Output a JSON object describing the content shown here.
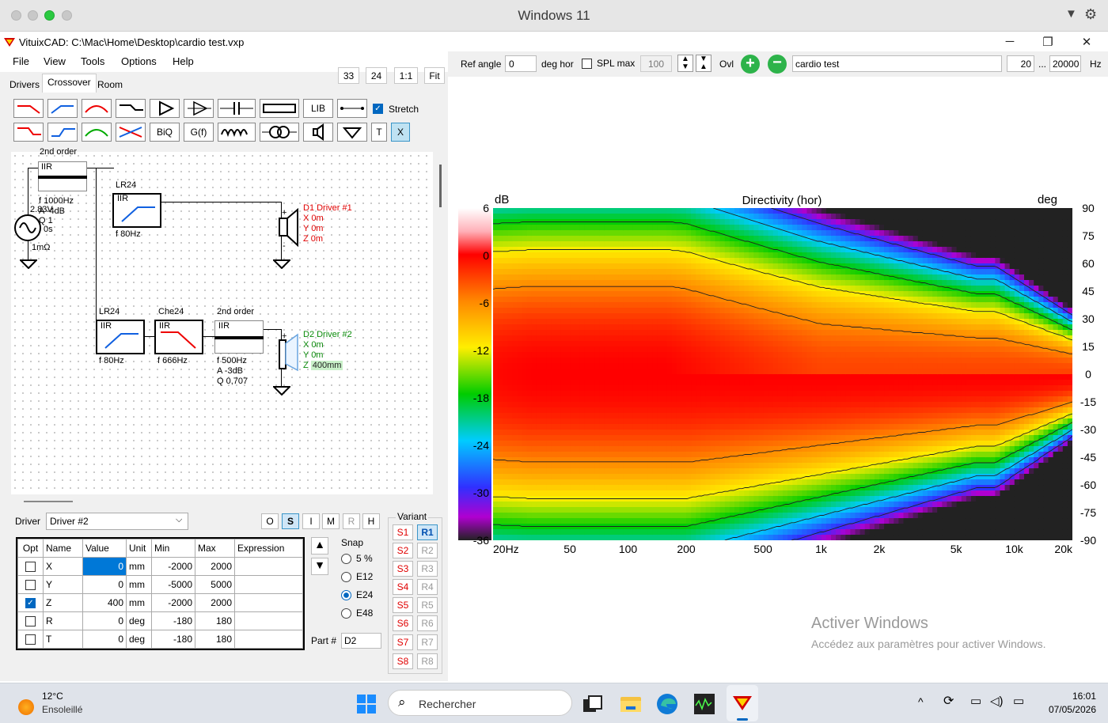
{
  "mac": {
    "title": "Windows 11"
  },
  "app": {
    "title": "VituixCAD: C:\\Mac\\Home\\Desktop\\cardio test.vxp",
    "min": "─",
    "max": "❐",
    "close": "✕"
  },
  "menu": [
    "File",
    "View",
    "Tools",
    "Options",
    "Help"
  ],
  "tabs": [
    "Drivers",
    "Crossover",
    "Room"
  ],
  "zoom": [
    "33",
    "24",
    "1:1",
    "Fit"
  ],
  "toolbar": {
    "lib": "LIB",
    "biq": "BiQ",
    "gf": "G(f)",
    "t": "T",
    "x": "X",
    "stretch": "Stretch"
  },
  "schematic": {
    "top_label": "2nd order",
    "iir1": "IIR",
    "source": {
      "f": "f  1000Hz",
      "v": "2.83V",
      "a": "A -4dB",
      "q": "Q 1",
      "t": "0s",
      "r": "1mΩ"
    },
    "lr24_a": {
      "title": "LR24",
      "tag": "IIR",
      "f": "f  80Hz"
    },
    "d1": {
      "name": "D1 Driver #1",
      "x": "X 0m",
      "y": "Y 0m",
      "z": "Z 0m"
    },
    "lr24_b": {
      "title": "LR24",
      "tag": "IIR",
      "f": "f  80Hz"
    },
    "che24": {
      "title": "Che24",
      "tag": "IIR",
      "f": "f  666Hz"
    },
    "order2": {
      "title": "2nd order",
      "tag": "IIR",
      "f": "f  500Hz",
      "a": "A  -3dB",
      "q": "Q  0,707"
    },
    "d2": {
      "name": "D2 Driver #2",
      "x": "X 0m",
      "y": "Y 0m",
      "z_prefix": "Z ",
      "z": "400mm"
    }
  },
  "driver_sel": {
    "label": "Driver",
    "value": "Driver #2"
  },
  "modes": [
    "O",
    "S",
    "I",
    "M",
    "R",
    "H"
  ],
  "params": {
    "headers": [
      "Opt",
      "Name",
      "Value",
      "Unit",
      "Min",
      "Max",
      "Expression"
    ],
    "rows": [
      {
        "opt": false,
        "name": "X",
        "value": "0",
        "unit": "mm",
        "min": "-2000",
        "max": "2000"
      },
      {
        "opt": false,
        "name": "Y",
        "value": "0",
        "unit": "mm",
        "min": "-5000",
        "max": "5000"
      },
      {
        "opt": true,
        "name": "Z",
        "value": "400",
        "unit": "mm",
        "min": "-2000",
        "max": "2000"
      },
      {
        "opt": false,
        "name": "R",
        "value": "0",
        "unit": "deg",
        "min": "-180",
        "max": "180"
      },
      {
        "opt": false,
        "name": "T",
        "value": "0",
        "unit": "deg",
        "min": "-180",
        "max": "180"
      }
    ]
  },
  "snap": {
    "label": "Snap",
    "options": [
      "5 %",
      "E12",
      "E24",
      "E48"
    ],
    "selected": "E24"
  },
  "part": {
    "label": "Part #",
    "value": "D2"
  },
  "variant": {
    "label": "Variant",
    "s": [
      "S1",
      "S2",
      "S3",
      "S4",
      "S5",
      "S6",
      "S7",
      "S8"
    ],
    "r": [
      "R1",
      "R2",
      "R3",
      "R4",
      "R5",
      "R6",
      "R7",
      "R8"
    ]
  },
  "right_toolbar": {
    "ref_angle_label": "Ref angle",
    "ref_angle": "0",
    "deg_hor": "deg hor",
    "spl_max_label": "SPL max",
    "spl_max": "100",
    "ovl": "Ovl",
    "name": "cardio test",
    "fmin": "20",
    "dots": "...",
    "fmax": "20000",
    "hz": "Hz"
  },
  "chart_data": {
    "type": "heatmap",
    "title": "Directivity (hor)",
    "zlabel": "dB",
    "ylabel": "deg",
    "color_scale_ticks": [
      "6",
      "0",
      "-6",
      "-12",
      "-18",
      "-24",
      "-30",
      "-36"
    ],
    "x_ticks": [
      "20Hz",
      "50",
      "100",
      "200",
      "500",
      "1k",
      "2k",
      "5k",
      "10k",
      "20k"
    ],
    "y_ticks": [
      "90",
      "75",
      "60",
      "45",
      "30",
      "15",
      "0",
      "-15",
      "-30",
      "-45",
      "-60",
      "-75",
      "-90"
    ],
    "xlim": [
      20,
      20000
    ],
    "ylim": [
      -90,
      90
    ],
    "zlim": [
      -36,
      6
    ],
    "x_scale": "log"
  },
  "watermark": {
    "title": "Activer Windows",
    "sub": "Accédez aux paramètres pour activer Windows."
  },
  "taskbar": {
    "temp": "12°C",
    "weather": "Ensoleillé",
    "search": "Rechercher",
    "time": "16:01",
    "date": "07/05/2026"
  }
}
